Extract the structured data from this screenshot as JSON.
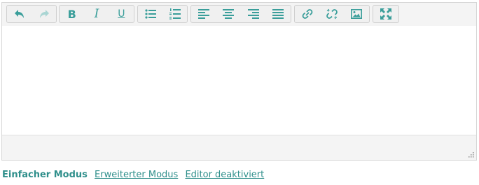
{
  "toolbar": {
    "groups": [
      {
        "buttons": [
          {
            "icon": "undo-icon",
            "enabled": true
          },
          {
            "icon": "redo-icon",
            "enabled": false
          }
        ]
      },
      {
        "buttons": [
          {
            "icon": "bold-icon",
            "glyph": "B"
          },
          {
            "icon": "italic-icon",
            "glyph": "I"
          },
          {
            "icon": "underline-icon",
            "glyph": "U"
          }
        ]
      },
      {
        "buttons": [
          {
            "icon": "bullet-list-icon"
          },
          {
            "icon": "numbered-list-icon"
          }
        ]
      },
      {
        "buttons": [
          {
            "icon": "align-left-icon"
          },
          {
            "icon": "align-center-icon"
          },
          {
            "icon": "align-right-icon"
          },
          {
            "icon": "align-justify-icon"
          }
        ]
      },
      {
        "buttons": [
          {
            "icon": "link-icon"
          },
          {
            "icon": "unlink-icon"
          },
          {
            "icon": "image-icon"
          }
        ]
      },
      {
        "buttons": [
          {
            "icon": "fullscreen-icon"
          }
        ]
      }
    ]
  },
  "editor": {
    "content": ""
  },
  "modes": {
    "simple": "Einfacher Modus",
    "advanced": "Erweiterter Modus",
    "disabled": "Editor deaktiviert"
  },
  "colors": {
    "accent": "#3a9e9a",
    "accent_disabled": "#a9d5d3",
    "toolbar_bg": "#f4f4f4",
    "border": "#d6d6d6"
  }
}
